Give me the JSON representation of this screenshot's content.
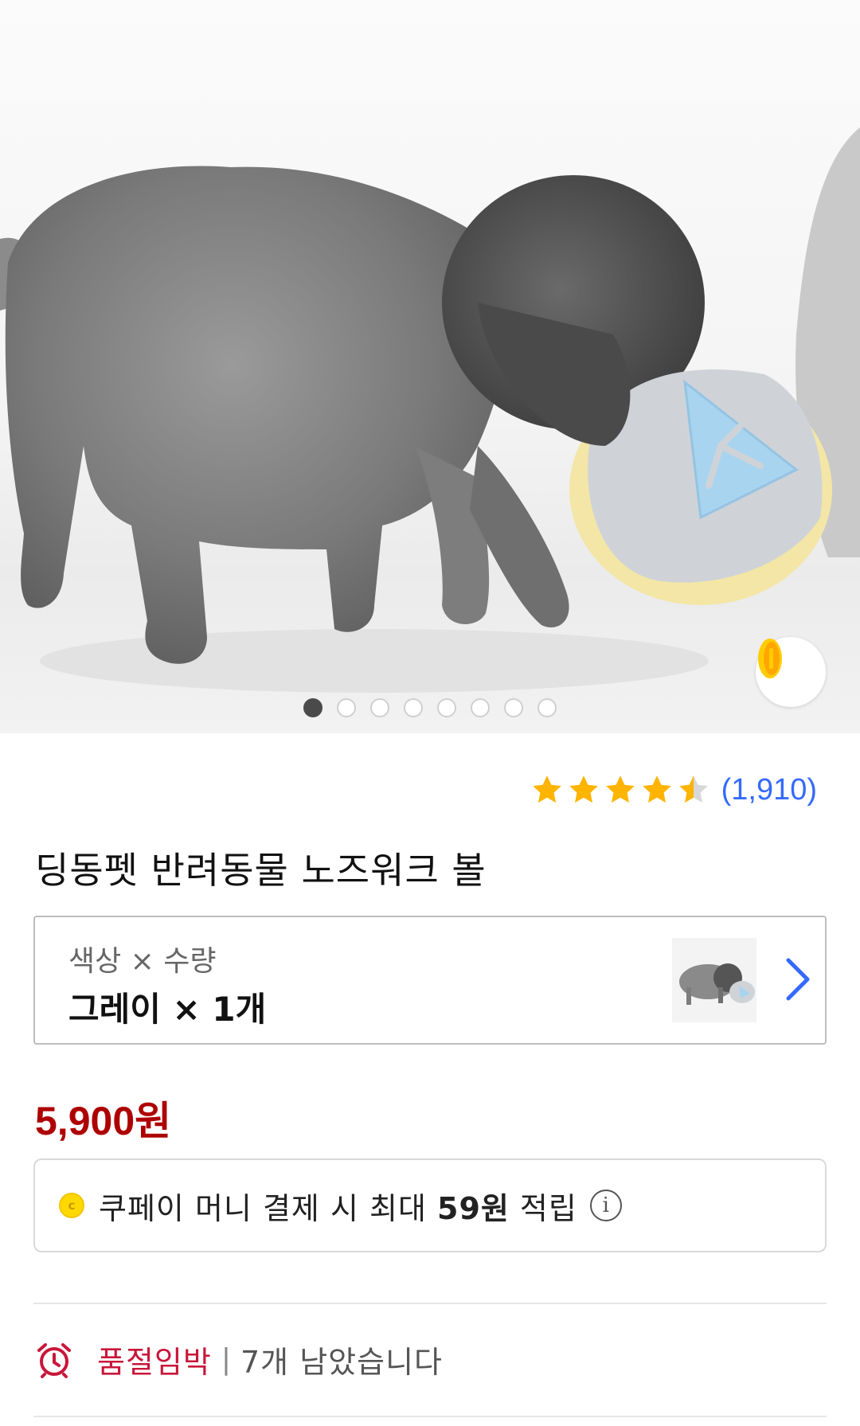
{
  "gallery": {
    "image_icon": "dog-with-nosework-ball-photo",
    "page_count": 8,
    "active_index": 0,
    "coin_button_icon": "coin-icon"
  },
  "rating": {
    "stars": 4.5,
    "count_label": "(1,910)",
    "star_color": "#ffb400"
  },
  "product": {
    "title": "딩동펫 반려동물 노즈워크 볼"
  },
  "option": {
    "label": "색상 × 수량",
    "value": "그레이 × 1개",
    "arrow_icon": "chevron-right-icon"
  },
  "price": {
    "value": "5,900원",
    "color": "#ae0000"
  },
  "cash": {
    "coin_letter": "c",
    "text_before": "쿠페이 머니 결제 시 최대 ",
    "amount": "59원",
    "text_after": " 적립",
    "info_symbol": "i"
  },
  "stock": {
    "icon": "alarm-clock-icon",
    "label": "품절임박",
    "separator": "|",
    "text": "7개 남았습니다",
    "accent": "#c8163a"
  }
}
